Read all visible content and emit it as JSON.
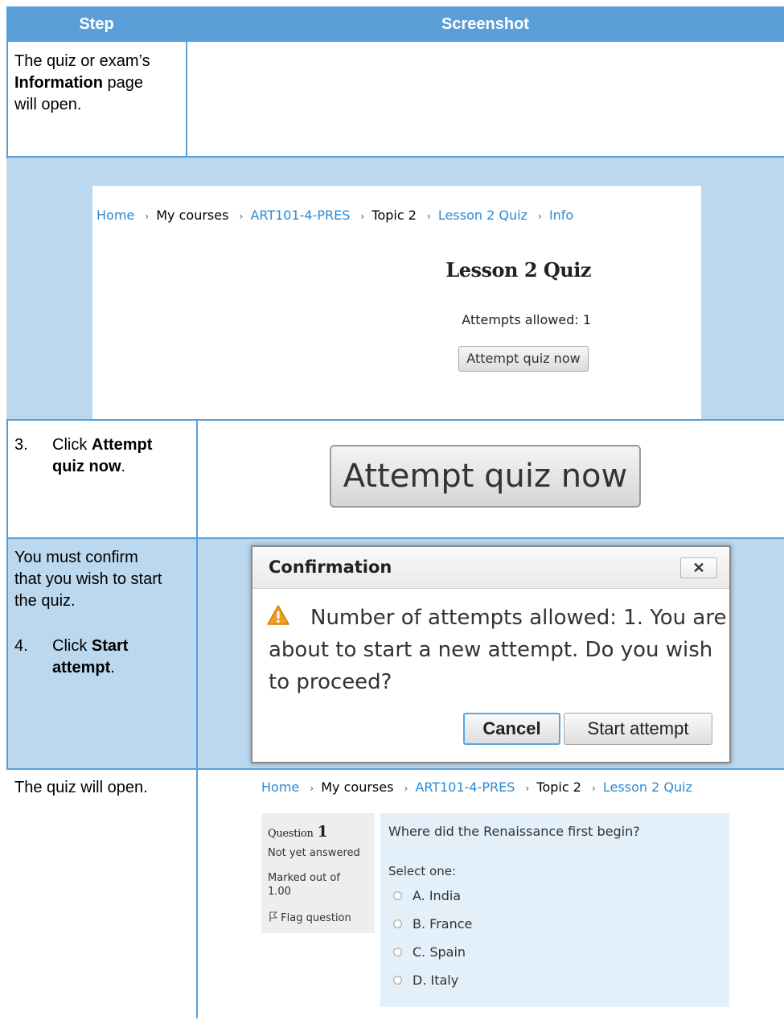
{
  "table": {
    "headers": [
      "Step",
      "Screenshot"
    ],
    "colors": {
      "header_bg": "#5b9fd8",
      "band_bg": "#bcd8ee",
      "link": "#2a8ad4"
    }
  },
  "row1": {
    "line1": "The quiz or exam’s",
    "line2_bold": "Information",
    "line2_rest": " page",
    "line3": "will open."
  },
  "info_page": {
    "breadcrumb": [
      "Home",
      "My courses",
      "ART101-4-PRES",
      "Topic 2",
      "Lesson 2 Quiz",
      "Info"
    ],
    "separator": "›",
    "title": "Lesson 2 Quiz",
    "attempts": "Attempts allowed: 1",
    "button": "Attempt quiz now"
  },
  "row3": {
    "number": "3.",
    "pre": "Click ",
    "bold1": "Attempt",
    "bold2": "quiz now",
    "post": ".",
    "button": "Attempt quiz now"
  },
  "row4": {
    "line1": "You must confirm",
    "line2": "that you wish to start",
    "line3": "the quiz.",
    "number": "4.",
    "pre": "Click ",
    "bold1": "Start",
    "bold2": "attempt",
    "post": "."
  },
  "dialog": {
    "title": "Confirmation",
    "close": "✕",
    "line1": "Number of attempts allowed: 1. You are",
    "line2": "about to start a new attempt. Do you wish",
    "line3": "to proceed?",
    "cancel": "Cancel",
    "start": "Start attempt"
  },
  "row5": {
    "text": "The quiz will open."
  },
  "quiz": {
    "breadcrumb": [
      "Home",
      "My courses",
      "ART101-4-PRES",
      "Topic 2",
      "Lesson 2 Quiz"
    ],
    "question_label": "Question",
    "question_number": "1",
    "status": "Not yet answered",
    "marked_line1": "Marked out of",
    "marked_line2": "1.00",
    "flag": "Flag question",
    "question_text": "Where did the Renaissance first begin?",
    "select_one": "Select one:",
    "options": [
      "A. India",
      "B. France",
      "C. Spain",
      "D. Italy"
    ]
  }
}
